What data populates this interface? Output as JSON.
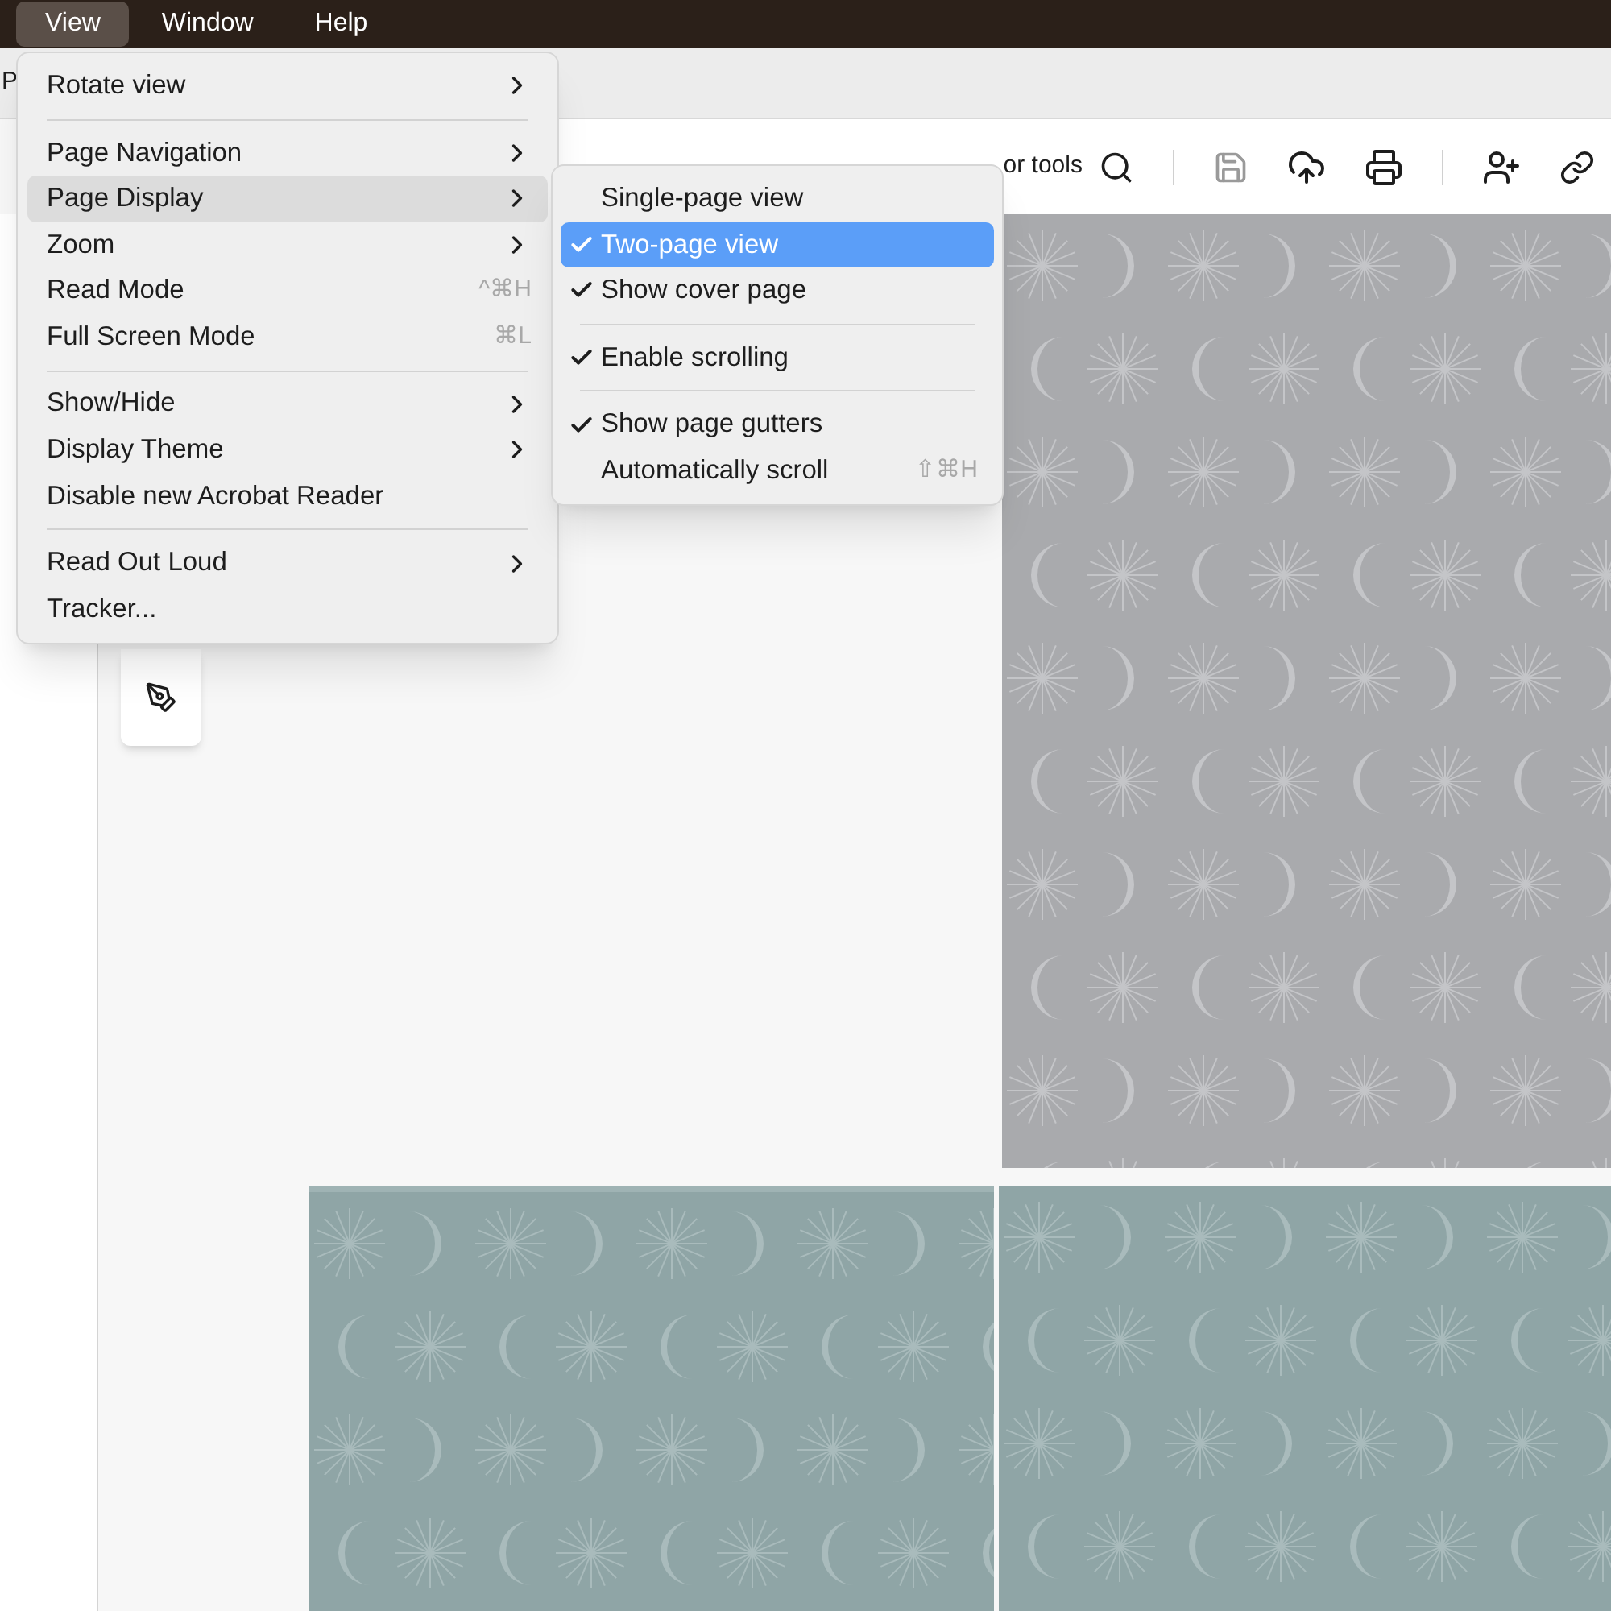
{
  "menu_bar": [
    {
      "label": "View",
      "selected": true
    },
    {
      "label": "Window",
      "selected": false
    },
    {
      "label": "Help",
      "selected": false
    }
  ],
  "tab_stub": "P",
  "toolbar": {
    "search_label": "or tools"
  },
  "view_menu": [
    {
      "kind": "item",
      "label": "Rotate view",
      "submenu": true,
      "selected": false
    },
    {
      "kind": "separator"
    },
    {
      "kind": "item",
      "label": "Page Navigation",
      "submenu": true,
      "selected": false
    },
    {
      "kind": "item",
      "label": "Page Display",
      "submenu": true,
      "selected": true
    },
    {
      "kind": "item",
      "label": "Zoom",
      "submenu": true,
      "selected": false
    },
    {
      "kind": "item",
      "label": "Read Mode",
      "shortcut": "^⌘H",
      "selected": false
    },
    {
      "kind": "item",
      "label": "Full Screen Mode",
      "shortcut": "⌘L",
      "selected": false
    },
    {
      "kind": "separator"
    },
    {
      "kind": "item",
      "label": "Show/Hide",
      "submenu": true,
      "selected": false
    },
    {
      "kind": "item",
      "label": "Display Theme",
      "submenu": true,
      "selected": false
    },
    {
      "kind": "item",
      "label": "Disable new Acrobat Reader",
      "selected": false
    },
    {
      "kind": "separator"
    },
    {
      "kind": "item",
      "label": "Read Out Loud",
      "submenu": true,
      "selected": false
    },
    {
      "kind": "item",
      "label": "Tracker...",
      "selected": false
    }
  ],
  "page_display_menu": [
    {
      "kind": "item",
      "label": "Single-page view",
      "checked": false,
      "selected": false
    },
    {
      "kind": "item",
      "label": "Two-page view",
      "checked": true,
      "selected": true
    },
    {
      "kind": "item",
      "label": "Show cover page",
      "checked": true,
      "selected": false
    },
    {
      "kind": "separator"
    },
    {
      "kind": "item",
      "label": "Enable scrolling",
      "checked": true,
      "selected": false
    },
    {
      "kind": "separator"
    },
    {
      "kind": "item",
      "label": "Show page gutters",
      "checked": true,
      "selected": false
    },
    {
      "kind": "item",
      "label": "Automatically scroll",
      "checked": false,
      "selected": false,
      "shortcut": "⇧⌘H"
    }
  ]
}
